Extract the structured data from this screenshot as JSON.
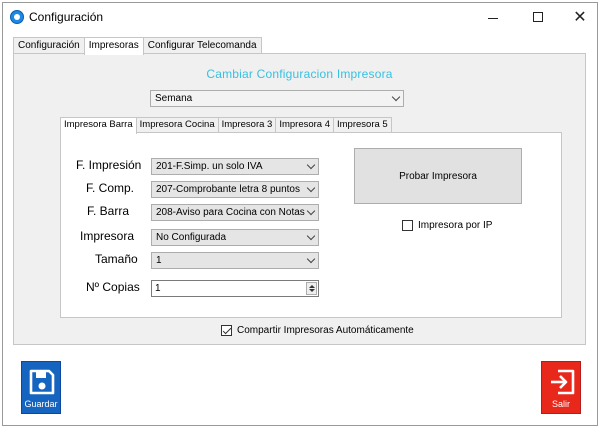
{
  "window": {
    "title": "Configuración",
    "controls": {
      "minimize": "minimize-icon",
      "maximize": "maximize-icon",
      "close": "close-icon"
    }
  },
  "top_tabs": [
    {
      "label": "Configuración",
      "active": false
    },
    {
      "label": "Impresoras",
      "active": true
    },
    {
      "label": "Configurar Telecomanda",
      "active": false
    }
  ],
  "section_title": "Cambiar Configuracion Impresora",
  "period_select": {
    "value": "Semana"
  },
  "printer_tabs": [
    {
      "label": "Impresora Barra",
      "active": true
    },
    {
      "label": "Impresora Cocina",
      "active": false
    },
    {
      "label": "Impresora 3",
      "active": false
    },
    {
      "label": "Impresora 4",
      "active": false
    },
    {
      "label": "Impresora 5",
      "active": false
    }
  ],
  "fields": {
    "f_impresion": {
      "label": "F.  Impresión",
      "value": "201-F.Simp. un solo IVA"
    },
    "f_comp": {
      "label": "F. Comp.",
      "value": "207-Comprobante letra 8 puntos"
    },
    "f_barra": {
      "label": "F. Barra",
      "value": "208-Aviso para Cocina con Notas"
    },
    "impresora": {
      "label": "Impresora",
      "value": "No Configurada"
    },
    "tamano": {
      "label": "Tamaño",
      "value": "1"
    },
    "copias": {
      "label": "Nº Copias",
      "value": "1"
    }
  },
  "probar_button": "Probar Impresora",
  "impresora_ip": {
    "label": "Impresora por IP",
    "checked": false
  },
  "compartir": {
    "label": "Compartir Impresoras Automáticamente",
    "checked": true
  },
  "bottom": {
    "save_label": "Guardar",
    "exit_label": "Salir"
  },
  "colors": {
    "title_accent": "#37c1e0",
    "save_button": "#1565c0",
    "exit_button": "#e8281b"
  }
}
